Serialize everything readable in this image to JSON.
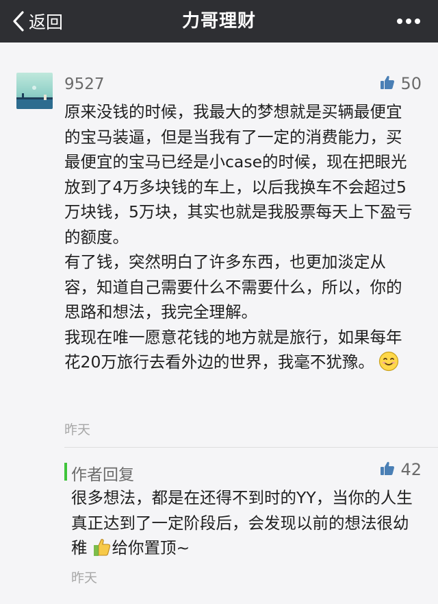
{
  "header": {
    "back_label": "返回",
    "title": "力哥理财",
    "more_icon": "more-dots-icon"
  },
  "comment": {
    "username": "9527",
    "likes": "50",
    "paragraphs": [
      "原来没钱的时候，我最大的梦想就是买辆最便宜的宝马装逼，但是当我有了一定的消费能力，买最便宜的宝马已经是小case的时候，现在把眼光放到了4万多块钱的车上，以后我换车不会超过5万块钱，5万块，其实也就是我股票每天上下盈亏的额度。",
      "有了钱，突然明白了许多东西，也更加淡定从容，知道自己需要什么不需要什么，所以，你的思路和想法，我完全理解。",
      "我现在唯一愿意花钱的地方就是旅行，如果每年花20万旅行去看外边的世界，我毫不犹豫。"
    ],
    "emoji": "smile-emoji",
    "time": "昨天"
  },
  "reply": {
    "author_label": "作者回复",
    "likes": "42",
    "text_before_emoji": "很多想法，都是在还得不到时的YY，当你的人生真正达到了一定阶段后，会发现以前的想法很幼稚",
    "emoji": "thumbs-up-emoji",
    "text_after_emoji": "给你置顶~",
    "time": "昨天"
  },
  "colors": {
    "topbar_bg": "#2e2f33",
    "page_bg": "#f5f5f7",
    "reply_accent": "#3fc43b",
    "like_icon": "#4a7fb5",
    "meta_text": "#a7a7a7"
  }
}
